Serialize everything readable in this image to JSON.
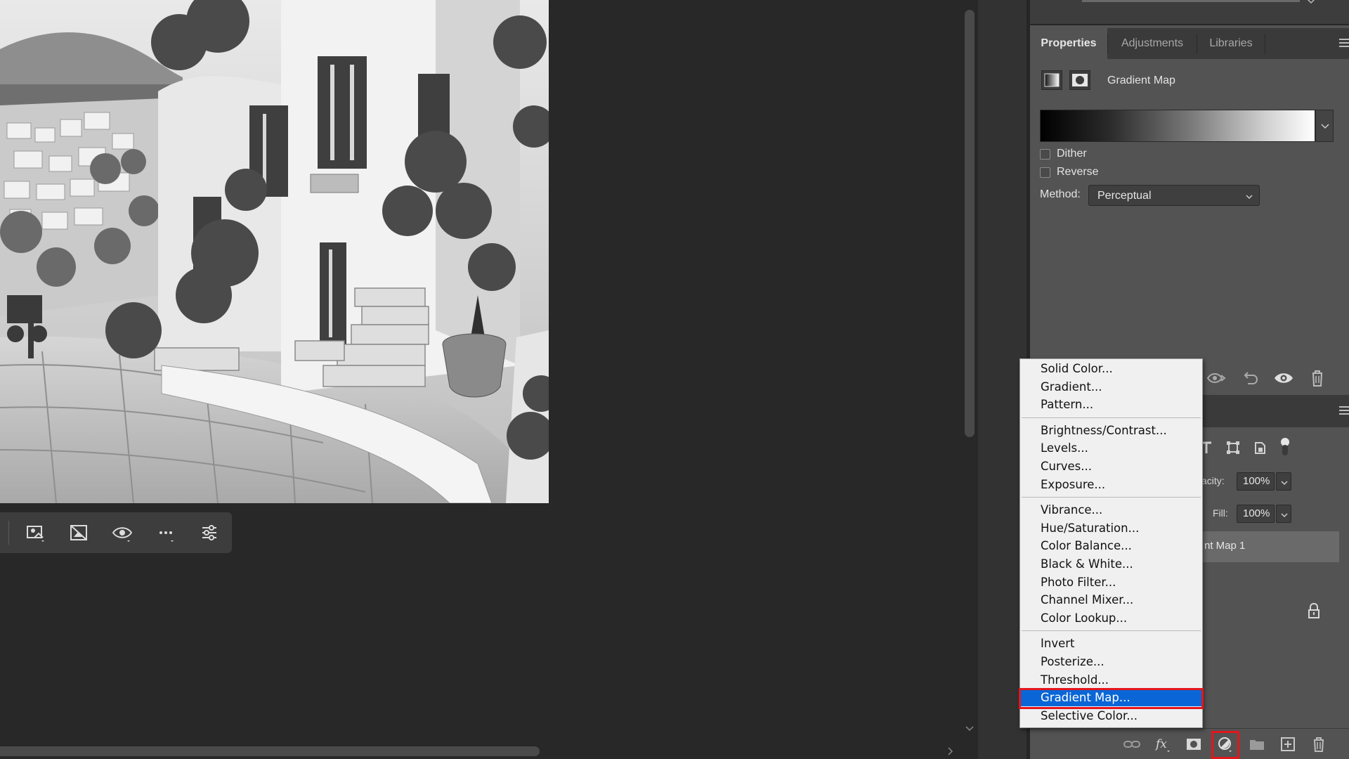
{
  "properties_panel": {
    "tabs": [
      "Properties",
      "Adjustments",
      "Libraries"
    ],
    "active_tab": "Properties",
    "header_title": "Gradient Map",
    "gradient": {
      "from": "#000000",
      "to": "#ffffff"
    },
    "dither_label": "Dither",
    "reverse_label": "Reverse",
    "method_label": "Method:",
    "method_value": "Perceptual"
  },
  "layers_panel": {
    "opacity_label": "acity:",
    "opacity_value": "100%",
    "fill_label": "Fill:",
    "fill_value": "100%",
    "selected_layer_name": "nt Map 1"
  },
  "adjustment_menu": {
    "groups": [
      [
        "Solid Color...",
        "Gradient...",
        "Pattern..."
      ],
      [
        "Brightness/Contrast...",
        "Levels...",
        "Curves...",
        "Exposure..."
      ],
      [
        "Vibrance...",
        "Hue/Saturation...",
        "Color Balance...",
        "Black & White...",
        "Photo Filter...",
        "Channel Mixer...",
        "Color Lookup..."
      ],
      [
        "Invert",
        "Posterize...",
        "Threshold...",
        "Gradient Map...",
        "Selective Color..."
      ]
    ],
    "selected_item": "Gradient Map..."
  },
  "colors": {
    "menu_selection": "#0a66d6",
    "highlight_annotation": "#e4161c",
    "panel_bg": "#535353",
    "workspace_bg": "#282828"
  }
}
